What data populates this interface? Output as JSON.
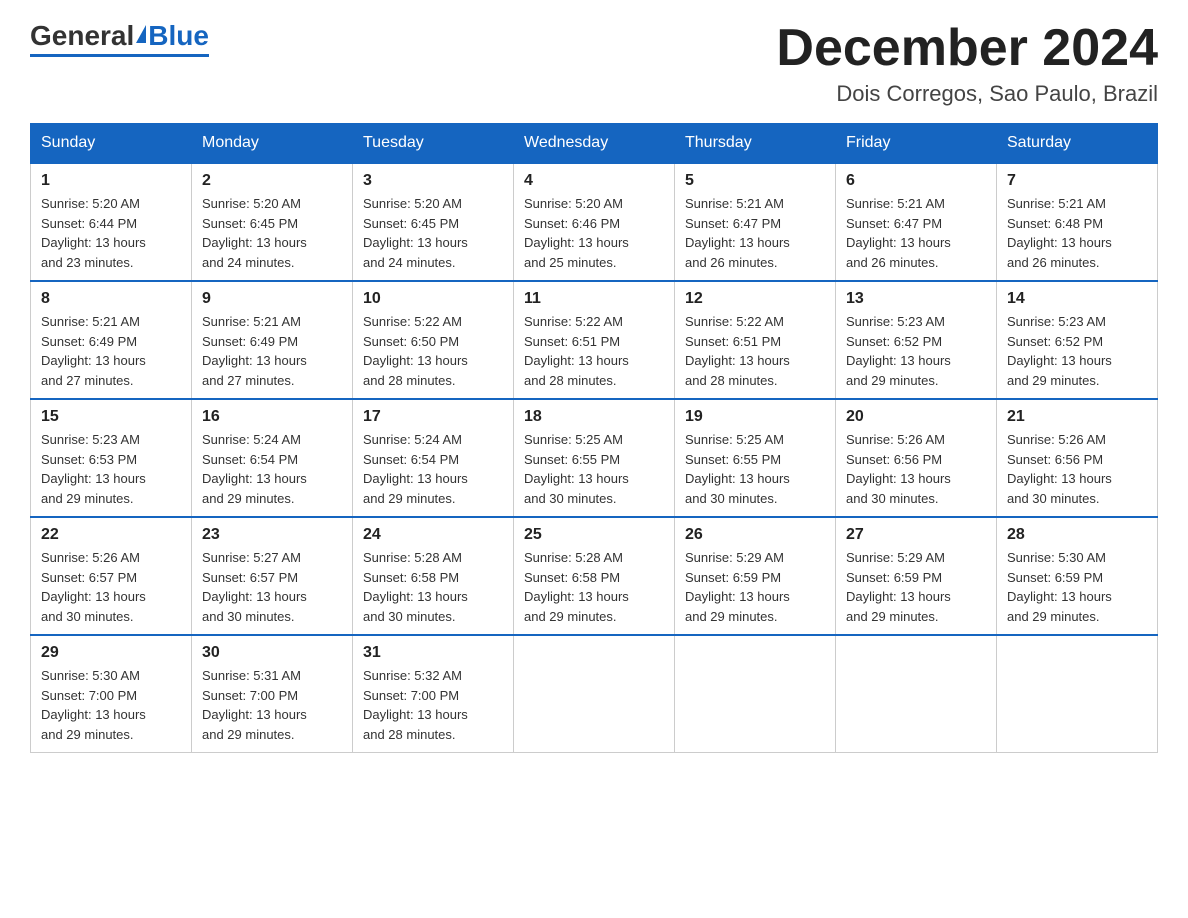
{
  "header": {
    "logo_general": "General",
    "logo_blue": "Blue",
    "month_title": "December 2024",
    "location": "Dois Corregos, Sao Paulo, Brazil"
  },
  "days_of_week": [
    "Sunday",
    "Monday",
    "Tuesday",
    "Wednesday",
    "Thursday",
    "Friday",
    "Saturday"
  ],
  "weeks": [
    [
      {
        "day": "1",
        "sunrise": "5:20 AM",
        "sunset": "6:44 PM",
        "daylight": "13 hours and 23 minutes."
      },
      {
        "day": "2",
        "sunrise": "5:20 AM",
        "sunset": "6:45 PM",
        "daylight": "13 hours and 24 minutes."
      },
      {
        "day": "3",
        "sunrise": "5:20 AM",
        "sunset": "6:45 PM",
        "daylight": "13 hours and 24 minutes."
      },
      {
        "day": "4",
        "sunrise": "5:20 AM",
        "sunset": "6:46 PM",
        "daylight": "13 hours and 25 minutes."
      },
      {
        "day": "5",
        "sunrise": "5:21 AM",
        "sunset": "6:47 PM",
        "daylight": "13 hours and 26 minutes."
      },
      {
        "day": "6",
        "sunrise": "5:21 AM",
        "sunset": "6:47 PM",
        "daylight": "13 hours and 26 minutes."
      },
      {
        "day": "7",
        "sunrise": "5:21 AM",
        "sunset": "6:48 PM",
        "daylight": "13 hours and 26 minutes."
      }
    ],
    [
      {
        "day": "8",
        "sunrise": "5:21 AM",
        "sunset": "6:49 PM",
        "daylight": "13 hours and 27 minutes."
      },
      {
        "day": "9",
        "sunrise": "5:21 AM",
        "sunset": "6:49 PM",
        "daylight": "13 hours and 27 minutes."
      },
      {
        "day": "10",
        "sunrise": "5:22 AM",
        "sunset": "6:50 PM",
        "daylight": "13 hours and 28 minutes."
      },
      {
        "day": "11",
        "sunrise": "5:22 AM",
        "sunset": "6:51 PM",
        "daylight": "13 hours and 28 minutes."
      },
      {
        "day": "12",
        "sunrise": "5:22 AM",
        "sunset": "6:51 PM",
        "daylight": "13 hours and 28 minutes."
      },
      {
        "day": "13",
        "sunrise": "5:23 AM",
        "sunset": "6:52 PM",
        "daylight": "13 hours and 29 minutes."
      },
      {
        "day": "14",
        "sunrise": "5:23 AM",
        "sunset": "6:52 PM",
        "daylight": "13 hours and 29 minutes."
      }
    ],
    [
      {
        "day": "15",
        "sunrise": "5:23 AM",
        "sunset": "6:53 PM",
        "daylight": "13 hours and 29 minutes."
      },
      {
        "day": "16",
        "sunrise": "5:24 AM",
        "sunset": "6:54 PM",
        "daylight": "13 hours and 29 minutes."
      },
      {
        "day": "17",
        "sunrise": "5:24 AM",
        "sunset": "6:54 PM",
        "daylight": "13 hours and 29 minutes."
      },
      {
        "day": "18",
        "sunrise": "5:25 AM",
        "sunset": "6:55 PM",
        "daylight": "13 hours and 30 minutes."
      },
      {
        "day": "19",
        "sunrise": "5:25 AM",
        "sunset": "6:55 PM",
        "daylight": "13 hours and 30 minutes."
      },
      {
        "day": "20",
        "sunrise": "5:26 AM",
        "sunset": "6:56 PM",
        "daylight": "13 hours and 30 minutes."
      },
      {
        "day": "21",
        "sunrise": "5:26 AM",
        "sunset": "6:56 PM",
        "daylight": "13 hours and 30 minutes."
      }
    ],
    [
      {
        "day": "22",
        "sunrise": "5:26 AM",
        "sunset": "6:57 PM",
        "daylight": "13 hours and 30 minutes."
      },
      {
        "day": "23",
        "sunrise": "5:27 AM",
        "sunset": "6:57 PM",
        "daylight": "13 hours and 30 minutes."
      },
      {
        "day": "24",
        "sunrise": "5:28 AM",
        "sunset": "6:58 PM",
        "daylight": "13 hours and 30 minutes."
      },
      {
        "day": "25",
        "sunrise": "5:28 AM",
        "sunset": "6:58 PM",
        "daylight": "13 hours and 29 minutes."
      },
      {
        "day": "26",
        "sunrise": "5:29 AM",
        "sunset": "6:59 PM",
        "daylight": "13 hours and 29 minutes."
      },
      {
        "day": "27",
        "sunrise": "5:29 AM",
        "sunset": "6:59 PM",
        "daylight": "13 hours and 29 minutes."
      },
      {
        "day": "28",
        "sunrise": "5:30 AM",
        "sunset": "6:59 PM",
        "daylight": "13 hours and 29 minutes."
      }
    ],
    [
      {
        "day": "29",
        "sunrise": "5:30 AM",
        "sunset": "7:00 PM",
        "daylight": "13 hours and 29 minutes."
      },
      {
        "day": "30",
        "sunrise": "5:31 AM",
        "sunset": "7:00 PM",
        "daylight": "13 hours and 29 minutes."
      },
      {
        "day": "31",
        "sunrise": "5:32 AM",
        "sunset": "7:00 PM",
        "daylight": "13 hours and 28 minutes."
      },
      null,
      null,
      null,
      null
    ]
  ],
  "labels": {
    "sunrise": "Sunrise:",
    "sunset": "Sunset:",
    "daylight": "Daylight:"
  }
}
